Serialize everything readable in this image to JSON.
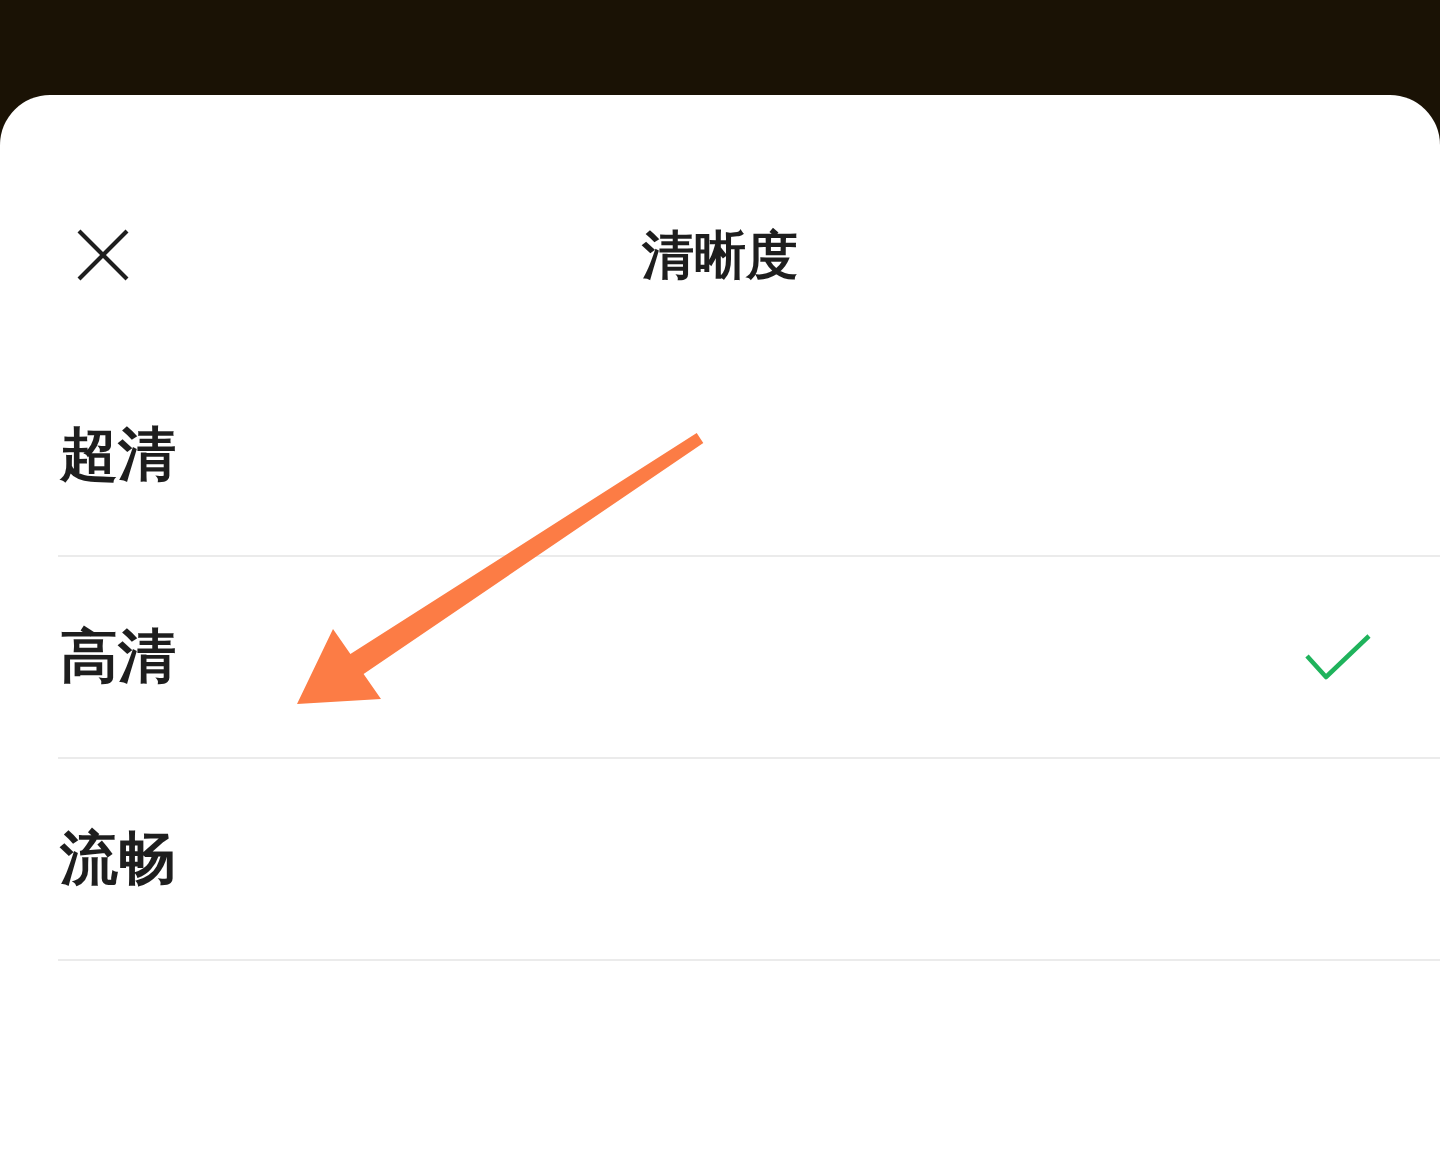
{
  "header": {
    "title": "清晰度"
  },
  "options": [
    {
      "label": "超清",
      "selected": false
    },
    {
      "label": "高清",
      "selected": true
    },
    {
      "label": "流畅",
      "selected": false
    }
  ],
  "annotations": [
    {
      "kind": "arrow"
    }
  ]
}
